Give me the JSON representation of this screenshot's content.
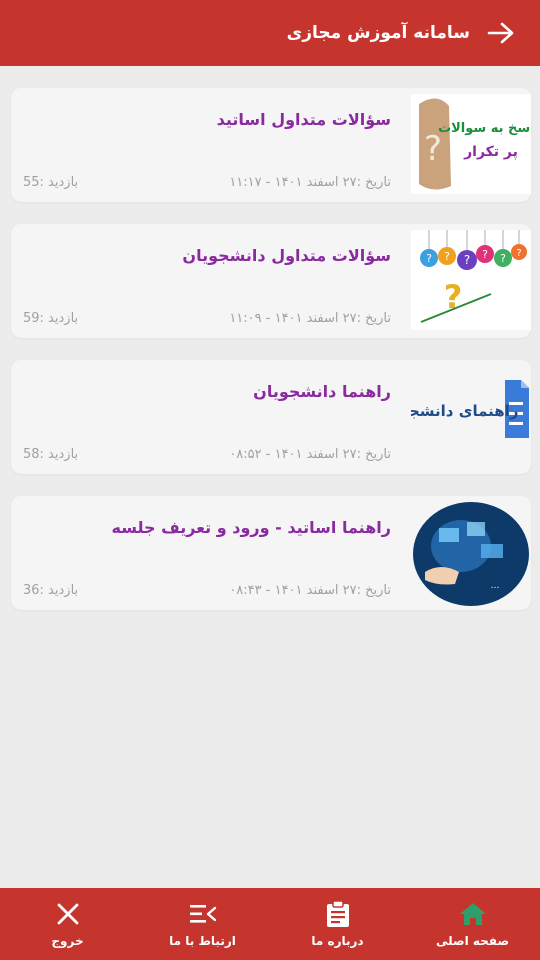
{
  "header": {
    "title": "سامانه آموزش مجازی",
    "back_icon": "arrow-right-icon"
  },
  "items": [
    {
      "title": "سؤالات متداول اساتید",
      "date": "تاریخ :۲۷ اسفند ۱۴۰۱ - ۱۱:۱۷",
      "views": "بازدید :55",
      "thumb_text_1": "پاسخ به سوالات",
      "thumb_text_2": "پر تکرار"
    },
    {
      "title": "سؤالات متداول دانشجویان",
      "date": "تاریخ :۲۷ اسفند ۱۴۰۱ - ۱۱:۰۹",
      "views": "بازدید :59"
    },
    {
      "title": "راهنما دانشجویان",
      "date": "تاریخ :۲۷ اسفند ۱۴۰۱ - ۰۸:۵۲",
      "views": "بازدید :58",
      "thumb_text_1": "راهنمای دانشجو"
    },
    {
      "title": "راهنما اساتید - ورود و تعریف جلسه",
      "date": "تاریخ :۲۷ اسفند ۱۴۰۱ - ۰۸:۴۳",
      "views": "بازدید :36"
    }
  ],
  "bottom_nav": [
    {
      "label": "صفحه اصلی",
      "icon": "home-icon",
      "active": true
    },
    {
      "label": "درباره ما",
      "icon": "clipboard-icon",
      "active": false
    },
    {
      "label": "ارتباط با ما",
      "icon": "menu-collapse-icon",
      "active": false
    },
    {
      "label": "خروج",
      "icon": "close-icon",
      "active": false
    }
  ],
  "colors": {
    "primary": "#c6352d",
    "title_purple": "#8a2aa0",
    "muted_text": "#a0a0a0",
    "background": "#ececec",
    "card": "#f5f5f5",
    "active_nav": "#2e9e6a"
  }
}
